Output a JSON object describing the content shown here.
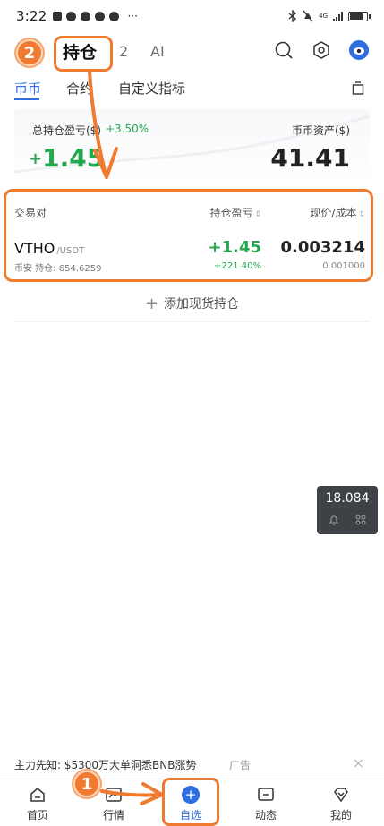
{
  "status_bar": {
    "time": "3:22",
    "more": "···",
    "network": "4G"
  },
  "top_tabs": {
    "holdings": "持仓",
    "tab2": "2",
    "ai": "AI"
  },
  "sub_tabs": {
    "spot": "币币",
    "contract": "合约",
    "custom": "自定义指标"
  },
  "summary": {
    "total_pnl_label": "总持仓盈亏($)",
    "total_pnl_pct": "+3.50%",
    "total_pnl_sign": "+",
    "total_pnl_value": "1.45",
    "asset_label": "币币资产($)",
    "asset_value": "41.41"
  },
  "holdings_table": {
    "headers": {
      "pair": "交易对",
      "pnl": "持仓盈亏",
      "price": "现价/成本"
    },
    "rows": [
      {
        "symbol": "VTHO",
        "quote": "/USDT",
        "sub": "币安 持仓: 654.6259",
        "pnl": "+1.45",
        "pnl_pct": "+221.40%",
        "price": "0.003214",
        "cost": "0.001000"
      }
    ]
  },
  "add_holding": {
    "plus": "+",
    "label": "添加现货持仓"
  },
  "float_widget": {
    "value": "18.084"
  },
  "ad": {
    "text": "主力先知: $5300万大单洞悉BNB涨势",
    "tag": "广告",
    "close": "×"
  },
  "bottom_nav": [
    {
      "label": "首页"
    },
    {
      "label": "行情"
    },
    {
      "label": "自选"
    },
    {
      "label": "动态"
    },
    {
      "label": "我的"
    }
  ],
  "annotations": {
    "badge1": "1",
    "badge2": "2"
  },
  "colors": {
    "accent_blue": "#2f6ede",
    "gain_green": "#25a750",
    "annotation_orange": "#f07a30"
  }
}
